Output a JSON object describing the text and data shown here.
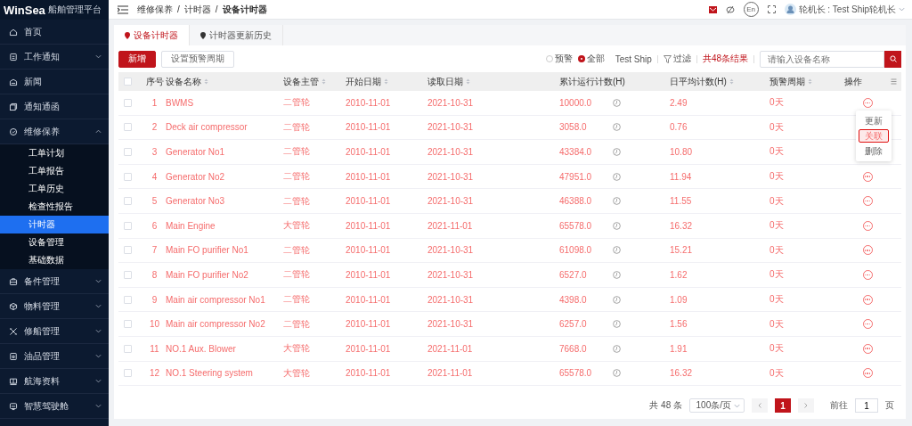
{
  "logo": {
    "brand": "WinSea",
    "subtitle": "船舶管理平台"
  },
  "sidebar": {
    "items": [
      {
        "label": "首页"
      },
      {
        "label": "工作通知",
        "expanded": false
      },
      {
        "label": "新闻"
      },
      {
        "label": "通知通函"
      },
      {
        "label": "维修保养",
        "expanded": true,
        "children": [
          {
            "label": "工单计划",
            "selected": false
          },
          {
            "label": "工单报告",
            "selected": false
          },
          {
            "label": "工单历史",
            "selected": false
          },
          {
            "label": "检查性报告",
            "selected": false
          },
          {
            "label": "计时器",
            "selected": true
          },
          {
            "label": "设备管理",
            "selected": false
          },
          {
            "label": "基础数据",
            "selected": false
          }
        ]
      },
      {
        "label": "备件管理",
        "expanded": false
      },
      {
        "label": "物料管理",
        "expanded": false
      },
      {
        "label": "修船管理",
        "expanded": false
      },
      {
        "label": "油品管理",
        "expanded": false
      },
      {
        "label": "航海资料",
        "expanded": false
      },
      {
        "label": "智慧驾驶舱",
        "expanded": false
      }
    ]
  },
  "breadcrumb": {
    "items": [
      "维修保养",
      "计时器",
      "设备计时器"
    ],
    "separator": "/"
  },
  "user": {
    "label": "轮机长 : Test Ship轮机长",
    "lang": "En"
  },
  "tabs": [
    {
      "label": "设备计时器",
      "selected": true
    },
    {
      "label": "计时器更新历史",
      "selected": false
    }
  ],
  "toolbar": {
    "add": "新增",
    "set_period": "设置预警周期",
    "radios": [
      {
        "label": "预警",
        "selected": false
      },
      {
        "label": "全部",
        "selected": true
      }
    ],
    "ship": "Test Ship",
    "filter": "过滤",
    "result": "共48条结果",
    "search_placeholder": "请输入设备名称"
  },
  "table": {
    "select_all_checked": false,
    "columns": [
      "序号",
      "设备名称",
      "设备主管",
      "开始日期",
      "读取日期",
      "累计运行计数(H)",
      "日平均计数(H)",
      "预警周期",
      "操作"
    ],
    "rows": [
      {
        "cells": [
          "1",
          "BWMS",
          "二管轮",
          "2010-11-01",
          "2021-10-31",
          "10000.0",
          "2.49",
          "0天"
        ],
        "checked": false
      },
      {
        "cells": [
          "2",
          "Deck air compressor",
          "二管轮",
          "2010-11-01",
          "2021-10-31",
          "3058.0",
          "0.76",
          "0天"
        ],
        "checked": false
      },
      {
        "cells": [
          "3",
          "Generator No1",
          "二管轮",
          "2010-11-01",
          "2021-10-31",
          "43384.0",
          "10.80",
          "0天"
        ],
        "checked": false
      },
      {
        "cells": [
          "4",
          "Generator No2",
          "二管轮",
          "2010-11-01",
          "2021-10-31",
          "47951.0",
          "11.94",
          "0天"
        ],
        "checked": false
      },
      {
        "cells": [
          "5",
          "Generator No3",
          "二管轮",
          "2010-11-01",
          "2021-10-31",
          "46388.0",
          "11.55",
          "0天"
        ],
        "checked": false
      },
      {
        "cells": [
          "6",
          "Main Engine",
          "大管轮",
          "2010-11-01",
          "2021-11-01",
          "65578.0",
          "16.32",
          "0天"
        ],
        "checked": false
      },
      {
        "cells": [
          "7",
          "Main FO purifier No1",
          "二管轮",
          "2010-11-01",
          "2021-10-31",
          "61098.0",
          "15.21",
          "0天"
        ],
        "checked": false
      },
      {
        "cells": [
          "8",
          "Main FO purifier No2",
          "二管轮",
          "2010-11-01",
          "2021-10-31",
          "6527.0",
          "1.62",
          "0天"
        ],
        "checked": false
      },
      {
        "cells": [
          "9",
          "Main air compressor No1",
          "二管轮",
          "2010-11-01",
          "2021-10-31",
          "4398.0",
          "1.09",
          "0天"
        ],
        "checked": false
      },
      {
        "cells": [
          "10",
          "Main air compressor No2",
          "二管轮",
          "2010-11-01",
          "2021-10-31",
          "6257.0",
          "1.56",
          "0天"
        ],
        "checked": false
      },
      {
        "cells": [
          "11",
          "NO.1 Aux. Blower",
          "大管轮",
          "2010-11-01",
          "2021-11-01",
          "7668.0",
          "1.91",
          "0天"
        ],
        "checked": false
      },
      {
        "cells": [
          "12",
          "NO.1 Steering system",
          "大管轮",
          "2010-11-01",
          "2021-11-01",
          "65578.0",
          "16.32",
          "0天"
        ],
        "checked": false
      }
    ],
    "action_menu": [
      {
        "label": "更新",
        "selected": false
      },
      {
        "label": "关联",
        "selected": true
      },
      {
        "label": "删除",
        "selected": false
      }
    ]
  },
  "pagination": {
    "total": "共 48 条",
    "size": "100条/页",
    "pages": [
      {
        "label": "1",
        "selected": true
      }
    ],
    "goto": "前往",
    "goto_value": "1",
    "page_unit": "页"
  }
}
